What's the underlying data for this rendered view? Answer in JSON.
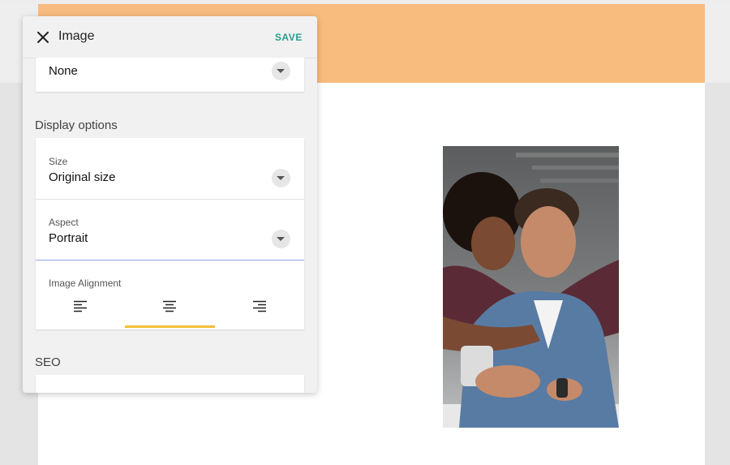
{
  "panel": {
    "title": "Image",
    "save_label": "SAVE",
    "link_select": {
      "value": "None"
    },
    "display_options": {
      "heading": "Display options",
      "size": {
        "label": "Size",
        "value": "Original size"
      },
      "aspect": {
        "label": "Aspect",
        "value": "Portrait"
      },
      "alignment": {
        "label": "Image Alignment",
        "options": [
          "align-left",
          "align-center",
          "align-right"
        ],
        "selected": "align-center"
      }
    },
    "seo": {
      "heading": "SEO"
    }
  },
  "colors": {
    "banner": "#f7bc7e",
    "accent_save": "#2a9d8f",
    "selected_indicator": "#f3bf3a",
    "focus_line": "#8ea8f0"
  }
}
